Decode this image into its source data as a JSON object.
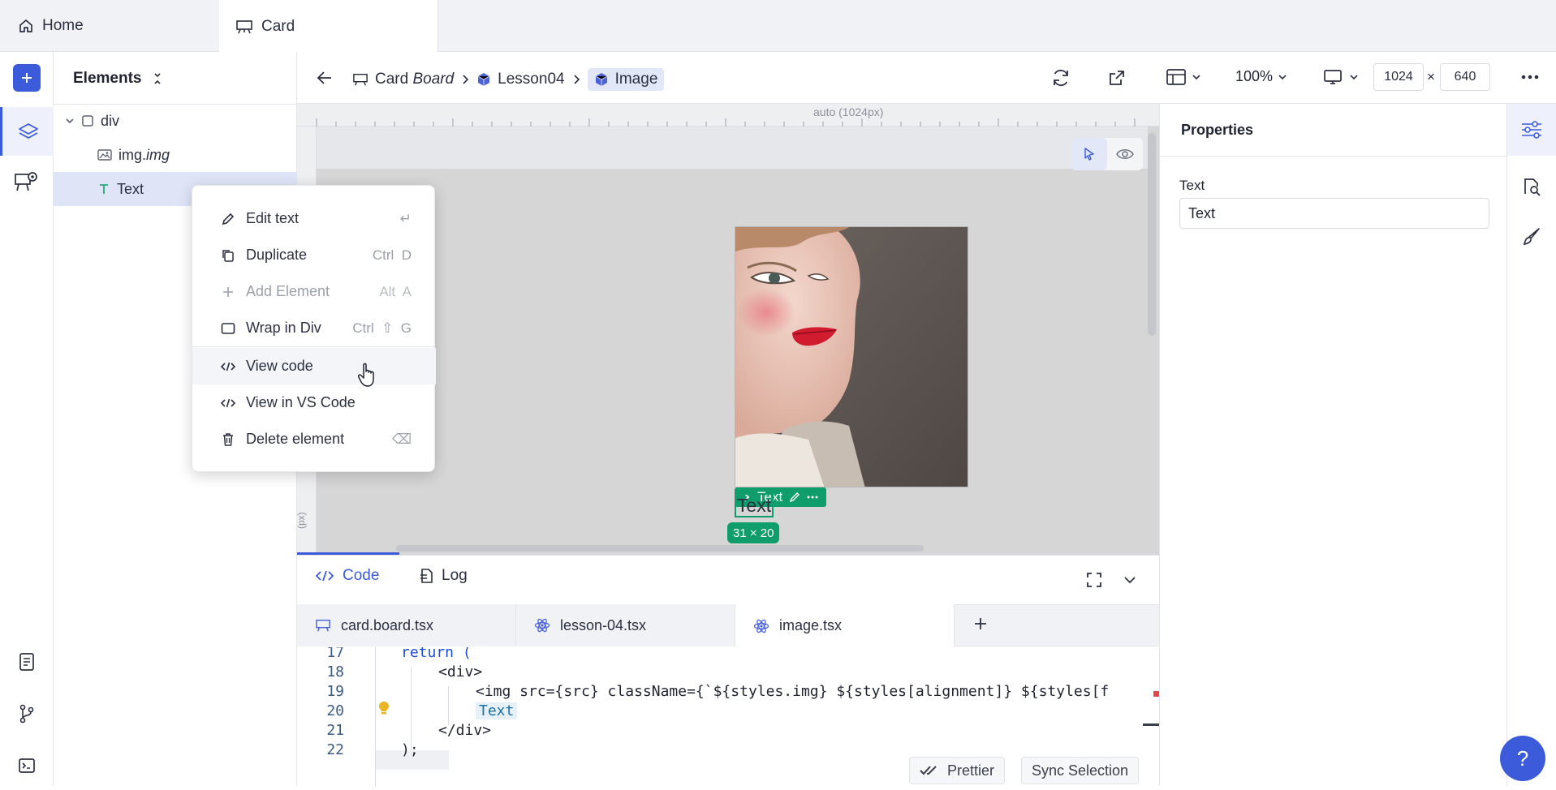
{
  "tabs": {
    "home": "Home",
    "card": "Card"
  },
  "elements_panel": {
    "title": "Elements",
    "tree": [
      {
        "label": "div"
      },
      {
        "label": "img.",
        "italic": "img"
      },
      {
        "label": "Text"
      }
    ]
  },
  "breadcrumb": {
    "item1_a": "Card",
    "item1_b": "Board",
    "item2": "Lesson04",
    "item3": "Image"
  },
  "toolbar": {
    "zoom": "100%",
    "width": "1024",
    "times": "×",
    "height": "640"
  },
  "ruler": {
    "label": "auto (1024px)"
  },
  "canvas": {
    "text_badge": "Text",
    "text_node": "Text",
    "size_badge": "31 × 20",
    "side_label": "(px)"
  },
  "context_menu": {
    "items": [
      {
        "label": "Edit text",
        "shortcut": "↵"
      },
      {
        "label": "Duplicate",
        "shortcut": "Ctrl  D"
      },
      {
        "label": "Add Element",
        "shortcut": "Alt  A"
      },
      {
        "label": "Wrap in Div",
        "shortcut": "Ctrl  ⇧  G"
      },
      {
        "label": "View code",
        "shortcut": ""
      },
      {
        "label": "View in VS Code",
        "shortcut": ""
      },
      {
        "label": "Delete element",
        "shortcut": "⌫"
      }
    ]
  },
  "properties": {
    "title": "Properties",
    "field_label": "Text",
    "field_value": "Text"
  },
  "code_panel": {
    "tab_code": "Code",
    "tab_log": "Log",
    "files": [
      "card.board.tsx",
      "lesson-04.tsx",
      "image.tsx"
    ],
    "lines": [
      {
        "n": "17",
        "code": "return ("
      },
      {
        "n": "18",
        "code": "<div>"
      },
      {
        "n": "19",
        "code": "<img src={src} className={`${styles.img} ${styles[alignment]} ${styles[f"
      },
      {
        "n": "20",
        "code": "Text"
      },
      {
        "n": "21",
        "code": "</div>"
      },
      {
        "n": "22",
        "code": ");"
      }
    ],
    "prettier": "Prettier",
    "sync": "Sync Selection"
  },
  "help": "?",
  "colors": {
    "accent": "#3b5bdb",
    "green": "#0f9d6b",
    "blue": "#2f6fdf"
  }
}
